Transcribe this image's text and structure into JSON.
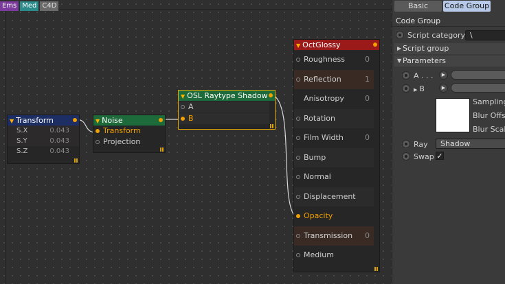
{
  "tabs": [
    "Ems",
    "Med",
    "C4D"
  ],
  "nodes": {
    "transform": {
      "title": "Transform",
      "rows": [
        {
          "label": "S.X",
          "value": "0.043"
        },
        {
          "label": "S.Y",
          "value": "0.043"
        },
        {
          "label": "S.Z",
          "value": "0.043"
        }
      ]
    },
    "noise": {
      "title": "Noise",
      "inputs": [
        "Transform",
        "Projection"
      ]
    },
    "osl": {
      "title": "OSL Raytype Shadow",
      "inputs": [
        "A",
        "B"
      ]
    },
    "glossy": {
      "title": "OctGlossy",
      "inputs": [
        {
          "label": "Roughness",
          "value": "0"
        },
        {
          "label": "Reflection",
          "value": "1"
        },
        {
          "label": "Anisotropy",
          "value": "0"
        },
        {
          "label": "Rotation",
          "value": ""
        },
        {
          "label": "Film Width",
          "value": "0"
        },
        {
          "label": "Bump",
          "value": ""
        },
        {
          "label": "Normal",
          "value": ""
        },
        {
          "label": "Displacement",
          "value": ""
        },
        {
          "label": "Opacity",
          "value": ""
        },
        {
          "label": "Transmission",
          "value": "0"
        },
        {
          "label": "Medium",
          "value": ""
        }
      ]
    }
  },
  "panel": {
    "tabs": {
      "basic": "Basic",
      "code_group": "Code Group"
    },
    "title": "Code Group",
    "script_category_label": "Script category",
    "script_category_value": "\\",
    "script_group_label": "Script group",
    "parameters_label": "Parameters",
    "param_a_label": "A . . .",
    "param_b_label": "B",
    "texture_labels": [
      "Sampling",
      "Blur Offse",
      "Blur Scale"
    ],
    "ray_label": "Ray",
    "ray_value": "Shadow",
    "swap_label": "Swap",
    "swap_check": "✓"
  },
  "colors": {
    "transform_header": "#1c2e63",
    "noise_header": "#1d6b3a",
    "osl_header": "#1d6b3a",
    "glossy_header": "#9a1a1a",
    "accent": "#f0a000",
    "active_tab": "#b7c9e8"
  }
}
